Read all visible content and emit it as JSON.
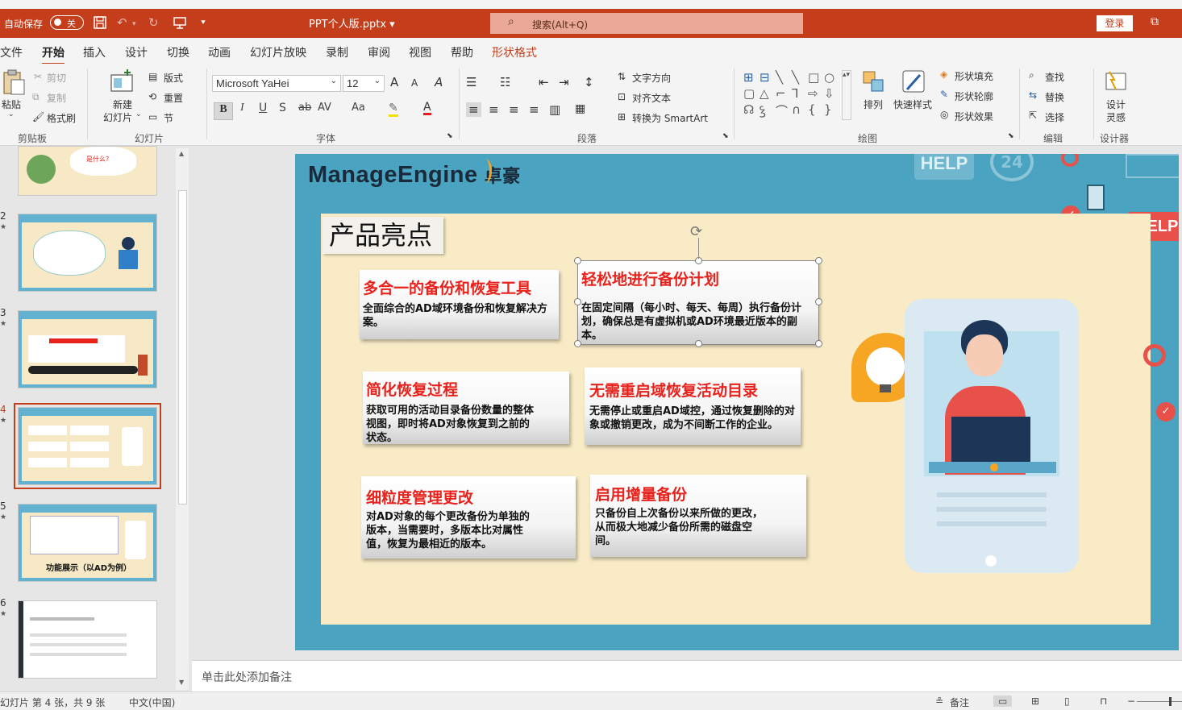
{
  "titlebar": {
    "autosave": "自动保存",
    "toggle": "关",
    "filename": "PPT个人版.pptx ▾",
    "search": "搜索(Alt+Q)",
    "login": "登录"
  },
  "menu": {
    "tabs": [
      "文件",
      "开始",
      "插入",
      "设计",
      "切换",
      "动画",
      "幻灯片放映",
      "录制",
      "审阅",
      "视图",
      "帮助",
      "形状格式"
    ]
  },
  "ribbon": {
    "clipboard": {
      "paste": "粘贴",
      "cut": "剪切",
      "copy": "复制",
      "format_painter": "格式刷",
      "group": "剪贴板"
    },
    "slides": {
      "new_slide": "新建",
      "new_slide2": "幻灯片",
      "layout": "版式",
      "reset": "重置",
      "section": "节",
      "group": "幻灯片"
    },
    "font": {
      "name": "Microsoft YaHei",
      "size": "12",
      "bold": "B",
      "italic": "I",
      "underline": "U",
      "shadow": "S",
      "strike": "ab",
      "spacing": "AV",
      "case": "Aa",
      "grow": "A",
      "shrink": "A",
      "clear": "A",
      "highlight": "✎",
      "fontcolor": "A",
      "group": "字体"
    },
    "paragraph": {
      "text_direction": "文字方向",
      "align_text": "对齐文本",
      "smartart": "转换为 SmartArt",
      "group": "段落"
    },
    "drawing": {
      "arrange": "排列",
      "quick_styles": "快速样式",
      "fill": "形状填充",
      "outline": "形状轮廓",
      "effects": "形状效果",
      "group": "绘图"
    },
    "editing": {
      "find": "查找",
      "replace": "替换",
      "select": "选择",
      "group": "编辑"
    },
    "designer": {
      "label1": "设计",
      "label2": "灵感",
      "group": "设计器"
    }
  },
  "thumbnails": [
    {
      "num": "",
      "text": "是什么?"
    },
    {
      "num": "2",
      "text": ""
    },
    {
      "num": "3",
      "text": ""
    },
    {
      "num": "4",
      "text": ""
    },
    {
      "num": "5",
      "text": "功能展示（以AD为例）"
    },
    {
      "num": "6",
      "text": ""
    }
  ],
  "slide": {
    "logo": "ManageEngine",
    "logo_cn": "卓豪",
    "title": "产品亮点",
    "help1": "HELP",
    "help2": "HELP",
    "badge": "24",
    "cards": [
      {
        "title": "多合一的备份和恢复工具",
        "body": "全面综合的AD域环境备份和恢复解决方案。"
      },
      {
        "title": "轻松地进行备份计划",
        "body": "在固定间隔（每小时、每天、每周）执行备份计划，确保总是有虚拟机或AD环境最近版本的副本。"
      },
      {
        "title": "简化恢复过程",
        "body": "获取可用的活动目录备份数量的整体视图，即时将AD对象恢复到之前的状态。"
      },
      {
        "title": "无需重启域恢复活动目录",
        "body": "无需停止或重启AD域控，通过恢复删除的对象或撤销更改，成为不间断工作的企业。"
      },
      {
        "title": "细粒度管理更改",
        "body": "对AD对象的每个更改备份为单独的版本，当需要时，多版本比对属性值，恢复为最相近的版本。"
      },
      {
        "title": "启用增量备份",
        "body": "只备份自上次备份以来所做的更改，从而极大地减少备份所需的磁盘空间。"
      }
    ]
  },
  "notes": {
    "placeholder": "单击此处添加备注"
  },
  "status": {
    "slide_info": "幻灯片 第 4 张，共 9 张",
    "language": "中文(中国)",
    "notes_btn": "备注"
  },
  "colors": {
    "accent": "#c43e1c",
    "slide_bg": "#4aa3c0",
    "content_bg": "#f8ebc6",
    "card_title": "#e8221c"
  }
}
